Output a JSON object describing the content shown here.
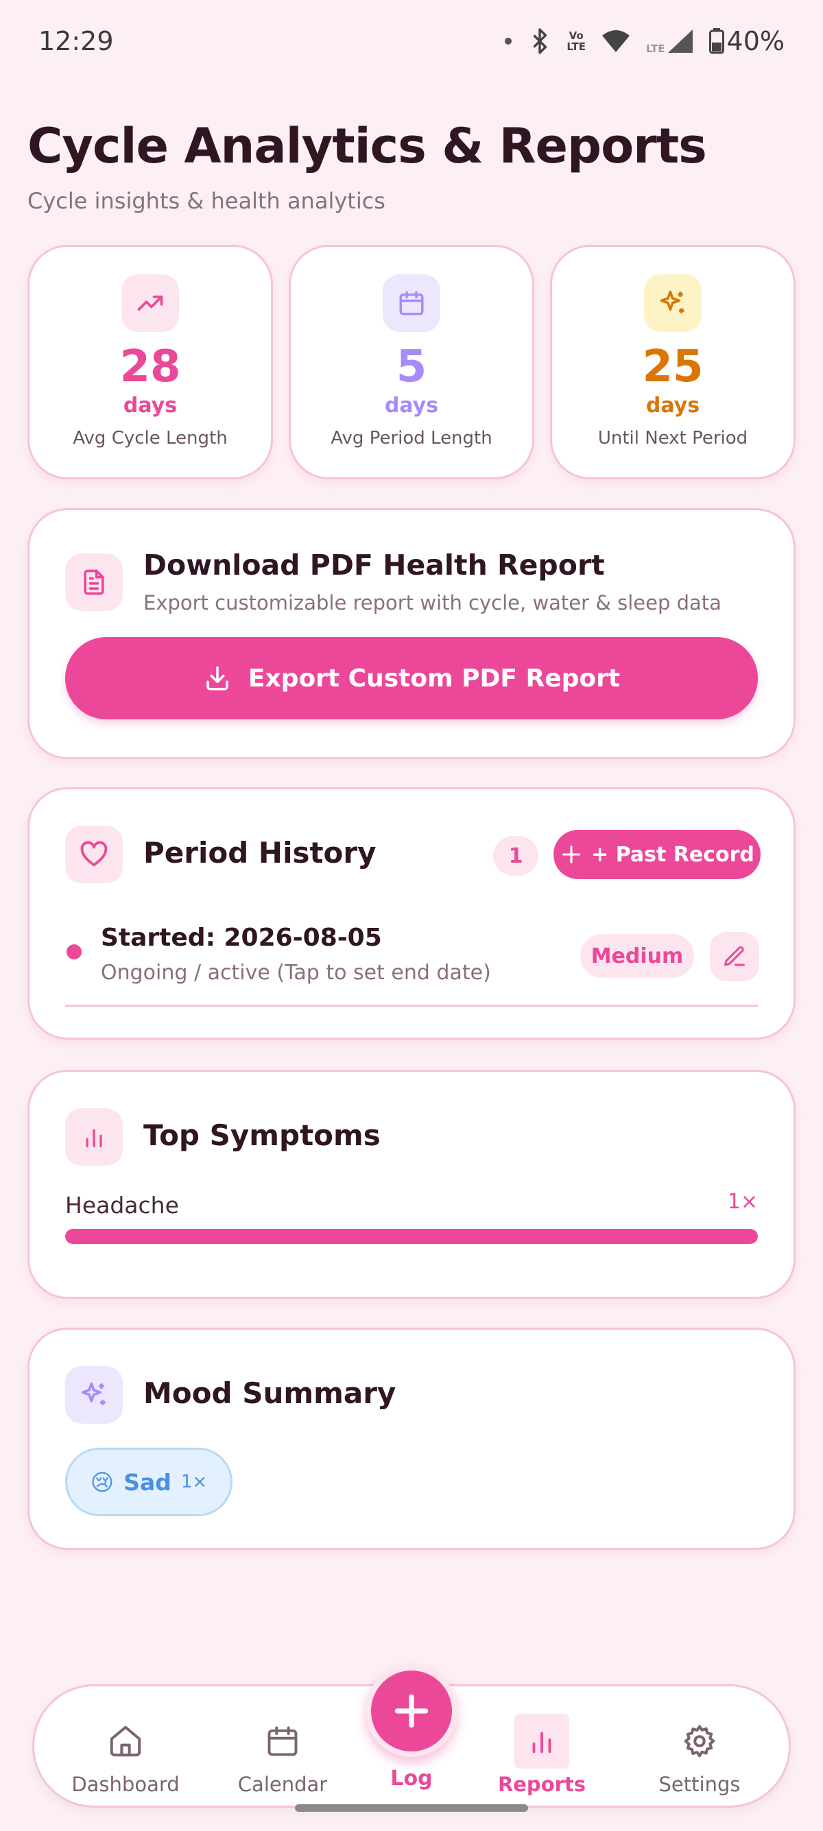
{
  "status_bar": {
    "time": "12:29",
    "volte": [
      "Vo",
      "LTE"
    ],
    "lte": "LTE",
    "battery": "40%"
  },
  "header": {
    "title": "Cycle Analytics & Reports",
    "subtitle": "Cycle insights & health analytics"
  },
  "stats": [
    {
      "icon": "trending-up-icon",
      "value": "28",
      "unit": "days",
      "label": "Avg Cycle Length",
      "color": "#ec4899",
      "icon_bg": "#fde5ef"
    },
    {
      "icon": "calendar-icon",
      "value": "5",
      "unit": "days",
      "label": "Avg Period Length",
      "color": "#a78bfa",
      "icon_bg": "#ede7fe"
    },
    {
      "icon": "sparkles-icon",
      "value": "25",
      "unit": "days",
      "label": "Until Next Period",
      "color": "#d97706",
      "icon_bg": "#fdf3c7"
    }
  ],
  "report": {
    "title": "Download PDF Health Report",
    "subtitle": "Export customizable report with cycle, water & sleep data",
    "button_label": "Export Custom PDF Report"
  },
  "history": {
    "title": "Period History",
    "count": "1",
    "add_label": "+ Past Record",
    "entries": [
      {
        "started": "Started: 2026-08-05",
        "status": "Ongoing / active (Tap to set end date)",
        "flow": "Medium"
      }
    ]
  },
  "symptoms": {
    "title": "Top Symptoms",
    "items": [
      {
        "name": "Headache",
        "count": "1×",
        "fraction": 1.0
      }
    ]
  },
  "mood": {
    "title": "Mood Summary",
    "items": [
      {
        "emoji": "😢",
        "label": "Sad",
        "count": "1×"
      }
    ]
  },
  "nav": {
    "items": [
      {
        "label": "Dashboard",
        "icon": "home-icon"
      },
      {
        "label": "Calendar",
        "icon": "calendar-icon"
      },
      {
        "label": "Log",
        "icon": "plus-icon"
      },
      {
        "label": "Reports",
        "icon": "bar-chart-icon",
        "active": true
      },
      {
        "label": "Settings",
        "icon": "gear-icon"
      }
    ]
  },
  "colors": {
    "accent": "#ec4899",
    "background": "#fdf0f4",
    "card_border": "#f5c4d8"
  }
}
